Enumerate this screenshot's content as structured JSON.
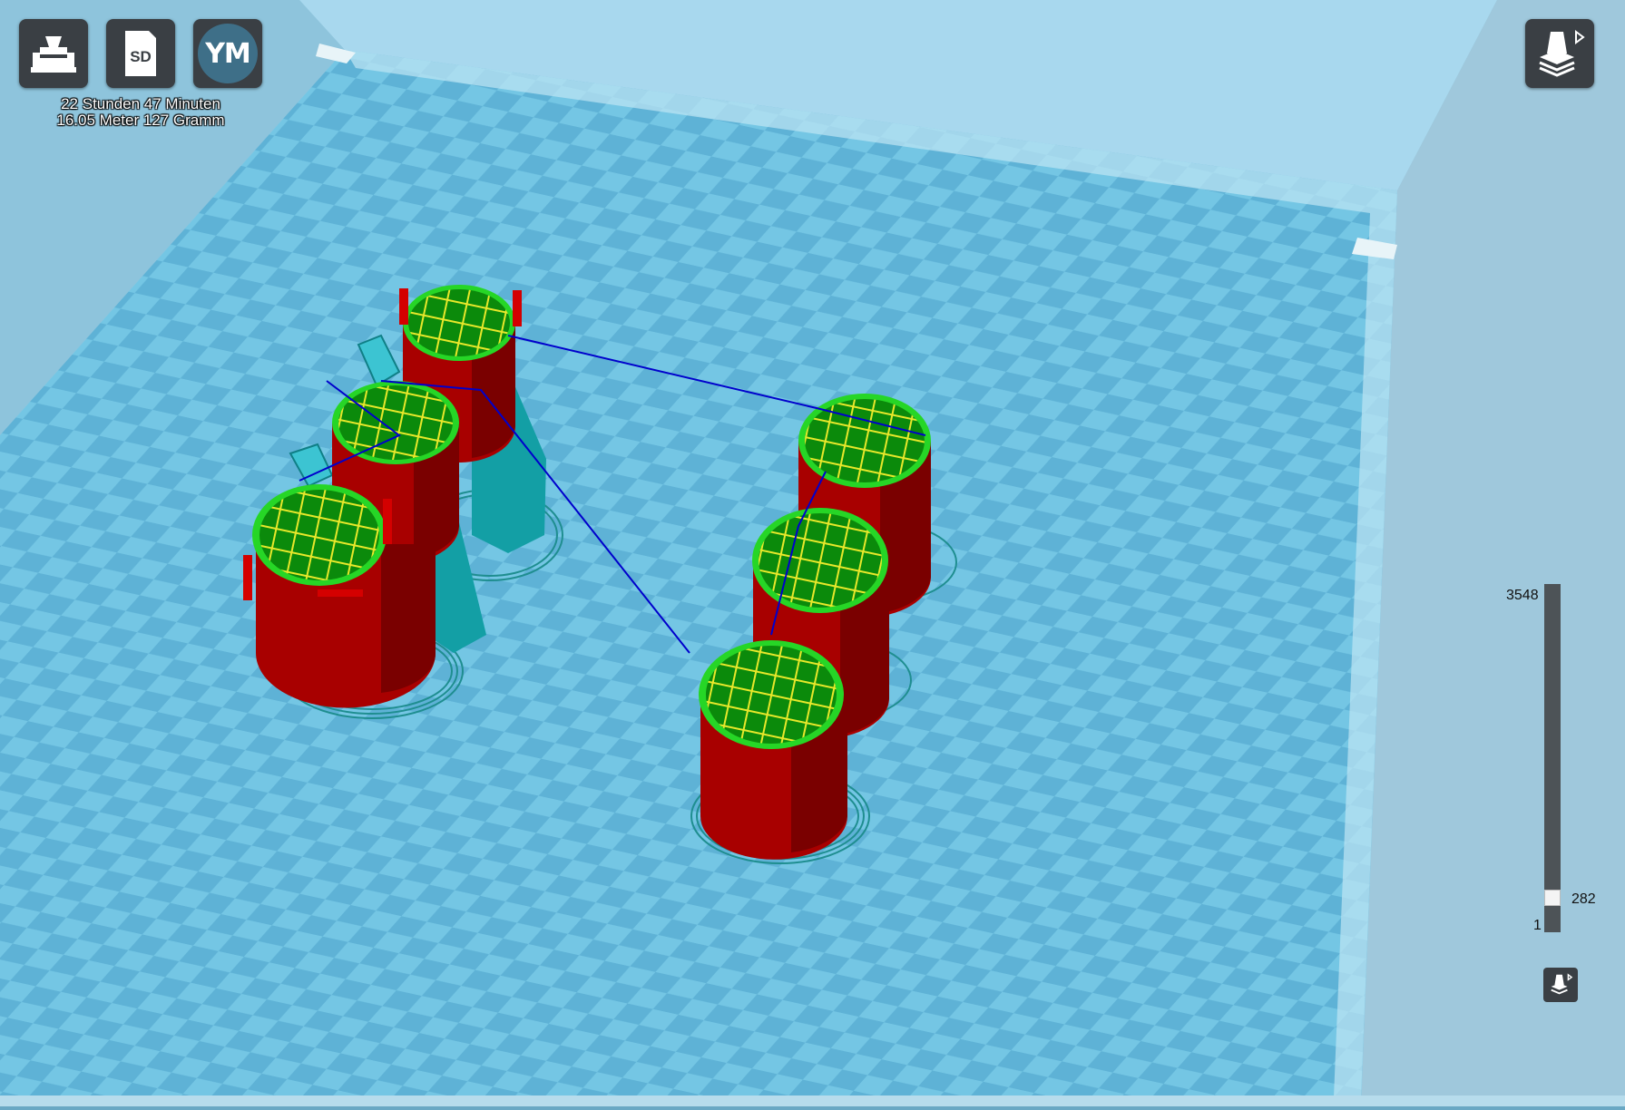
{
  "toolbar": {
    "print_icon": "printer-icon",
    "sd_label": "SD",
    "ym_label": "YM",
    "layer_view_icon": "layer-view-icon"
  },
  "print_info": {
    "time": "22 Stunden 47 Minuten",
    "material": "16.05 Meter 127 Gramm"
  },
  "layer_slider": {
    "max": "3548",
    "current": "282",
    "min": "1",
    "current_fraction": 0.079
  },
  "colors": {
    "bed_light": "#7ccbe6",
    "bed_dark": "#5aaed2",
    "wall": "#b00000",
    "infill": "#e8e82a",
    "skin": "#0b8a0b",
    "outline": "#26d626",
    "support": "#1aa3a8",
    "travel": "#0000cc"
  }
}
